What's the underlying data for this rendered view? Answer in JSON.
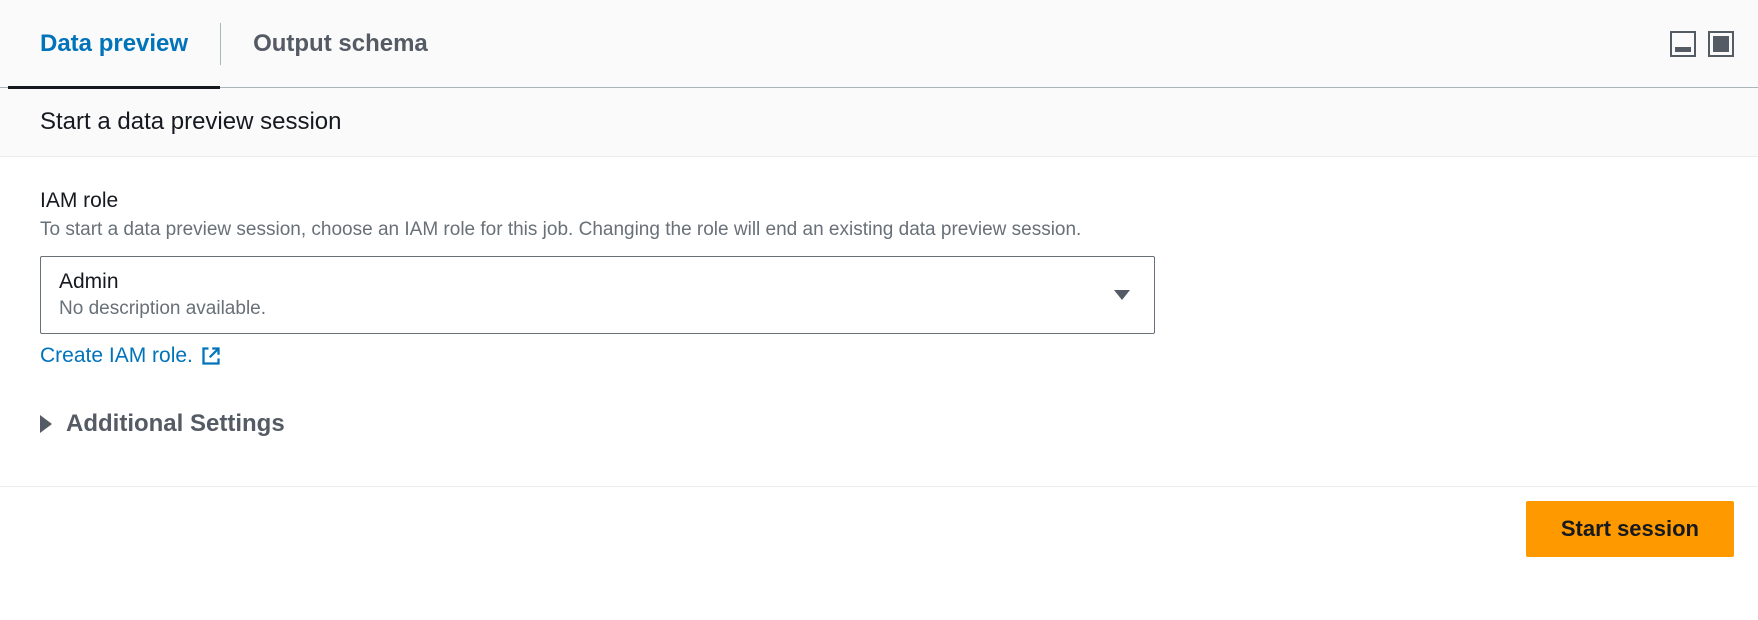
{
  "tabs": {
    "data_preview": "Data preview",
    "output_schema": "Output schema"
  },
  "section": {
    "title": "Start a data preview session"
  },
  "iam_role": {
    "label": "IAM role",
    "description": "To start a data preview session, choose an IAM role for this job. Changing the role will end an existing data preview session.",
    "selected_value": "Admin",
    "selected_subtext": "No description available.",
    "create_link": "Create IAM role."
  },
  "additional_settings": {
    "label": "Additional Settings"
  },
  "actions": {
    "start_session": "Start session"
  }
}
